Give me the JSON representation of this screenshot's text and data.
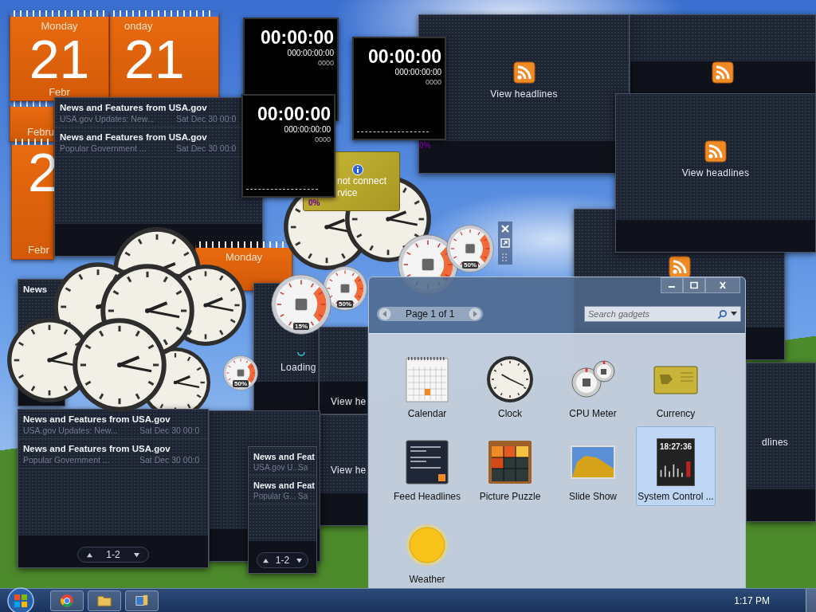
{
  "headline_panels": [
    {
      "kind": "headlines"
    },
    {
      "kind": "headlines",
      "label": "View headlines"
    },
    {
      "kind": "headlines"
    },
    {
      "kind": "headlines",
      "label": "View headlines"
    },
    {
      "kind": "headlines",
      "label": "dlines"
    },
    {
      "kind": "empty"
    },
    {
      "kind": "headlines",
      "label": "View he"
    },
    {
      "kind": "headlines",
      "label": "View he"
    },
    {
      "kind": "loading",
      "label": "Loading"
    }
  ],
  "calendars": [
    {
      "weekday": "Monday",
      "day": "21",
      "month": "Febr"
    },
    {
      "weekday": "onday",
      "day": "21"
    },
    {
      "month": "Febru"
    },
    {
      "day": "2",
      "month": "Febr"
    },
    {
      "weekday": "Monday"
    }
  ],
  "feeds": [
    {
      "items": [
        {
          "title": "News and Features from USA.gov",
          "summary": "USA.gov Updates: New...",
          "date": "Sat Dec 30 00:0"
        },
        {
          "title": "News and Features from USA.gov",
          "summary": "Popular Government ...",
          "date": "Sat Dec 30 00:0"
        }
      ]
    },
    {
      "items": [
        {
          "title": "News"
        }
      ]
    },
    {
      "items": [
        {
          "title": "News and Features from USA.gov",
          "summary": "USA.gov Updates: New...",
          "date": "Sat Dec 30 00:0"
        },
        {
          "title": "News and Features from USA.gov",
          "summary": "Popular Government ...",
          "date": "Sat Dec 30 00:0"
        }
      ],
      "pager": "1-2"
    },
    {
      "items": [
        {
          "title": "News and Feat",
          "summary": "USA.gov U...",
          "date": "Sa"
        },
        {
          "title": "News and Feat",
          "summary": "Popular G...",
          "date": "Sa"
        }
      ],
      "pager": "1-2"
    }
  ],
  "stopwatches": [
    {
      "time": "00:00:00",
      "detail": "000:00:00:00",
      "count": "0000"
    },
    {
      "time": "00:00:00",
      "detail": "000:00:00:00",
      "count": "0000",
      "percent": "0%"
    },
    {
      "time": "00:00:00",
      "detail": "000:00:00:00",
      "count": "0000",
      "percent": "0%"
    }
  ],
  "currency": {
    "lines": [
      "not connect",
      "rvice"
    ]
  },
  "cpu_meters": [
    {
      "reading": "50%"
    },
    {
      "reading": "50%"
    },
    {
      "reading": "50%"
    },
    {
      "reading": "15%"
    }
  ],
  "gallery": {
    "pager": "Page 1 of 1",
    "search_placeholder": "Search gadgets",
    "items": [
      {
        "kind": "calendar",
        "label": "Calendar",
        "selected": false
      },
      {
        "kind": "clock",
        "label": "Clock",
        "selected": false
      },
      {
        "kind": "cpu",
        "label": "CPU Meter",
        "selected": false
      },
      {
        "kind": "currency",
        "label": "Currency",
        "selected": false
      },
      {
        "kind": "feed",
        "label": "Feed Headlines",
        "selected": false
      },
      {
        "kind": "puzzle",
        "label": "Picture Puzzle",
        "selected": false
      },
      {
        "kind": "slideshow",
        "label": "Slide Show",
        "selected": false
      },
      {
        "kind": "system",
        "label": "System Control ...",
        "preview": "18:27:36",
        "selected": true
      },
      {
        "kind": "weather",
        "label": "Weather",
        "selected": false
      }
    ]
  },
  "taskbar": {
    "pinned": [
      {
        "kind": "browser"
      },
      {
        "kind": "folder"
      },
      {
        "kind": "app"
      }
    ],
    "clock": "1:17 PM"
  }
}
